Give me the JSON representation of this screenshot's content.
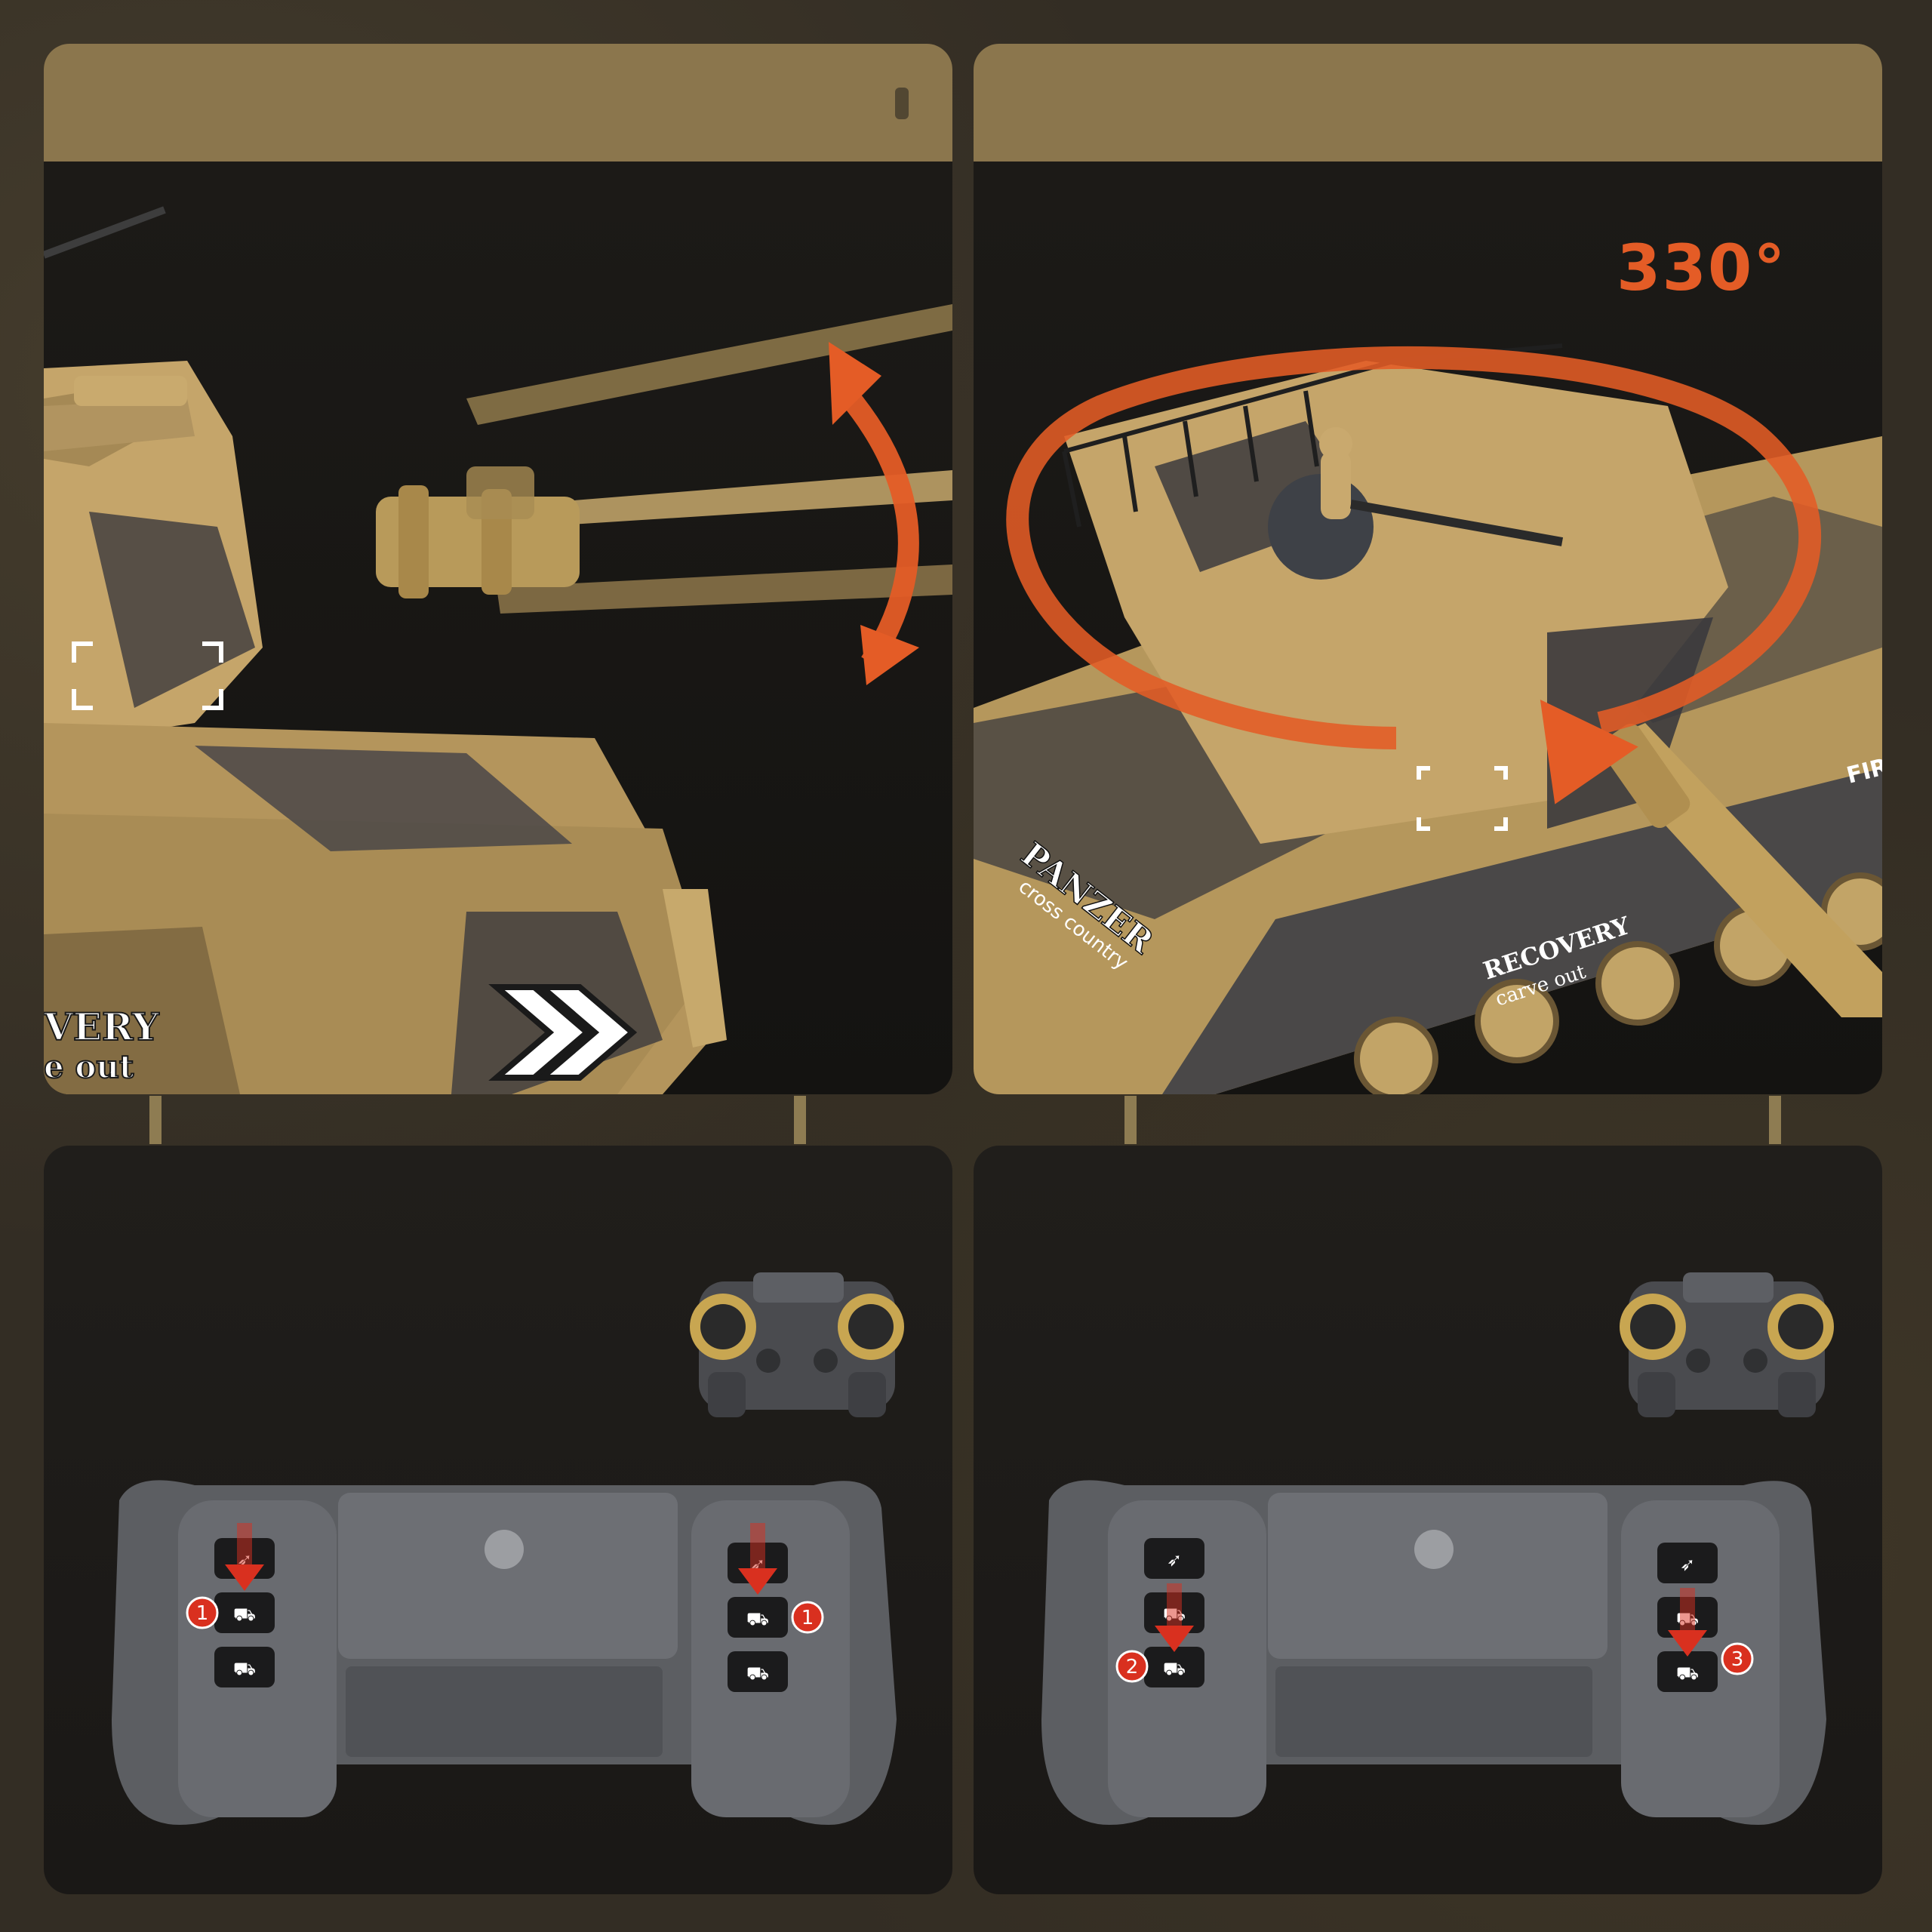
{
  "panels": {
    "top_left": {
      "header_text": "",
      "tank_side_text_1": "VERY",
      "tank_side_text_2": "e out"
    },
    "top_right": {
      "header_text": "",
      "rotation_label": "330°",
      "tank_text_1": "PANZER",
      "tank_text_2": "cross country",
      "tank_text_3": "RECOVERY",
      "tank_text_4": "carve out",
      "tank_text_5": "FIRE"
    },
    "bottom_left": {
      "badge_left": "1",
      "badge_right": "1"
    },
    "bottom_right": {
      "badge_left": "2",
      "badge_right": "3"
    }
  },
  "colors": {
    "accent_orange": "#e45c26",
    "header_tan": "#8b764d",
    "tank_tan": "#b89960",
    "camo_dark": "#3b3a3d",
    "badge_red": "#d9301f"
  },
  "icons": {
    "barrel_elevation_arrow": "curved-double-arrow-icon",
    "turret_rotation_arrow": "circular-arrow-icon",
    "fire_shell_button": "shell-icon",
    "tank_button": "tank-icon",
    "recoil_button": "tank-recoil-icon"
  }
}
